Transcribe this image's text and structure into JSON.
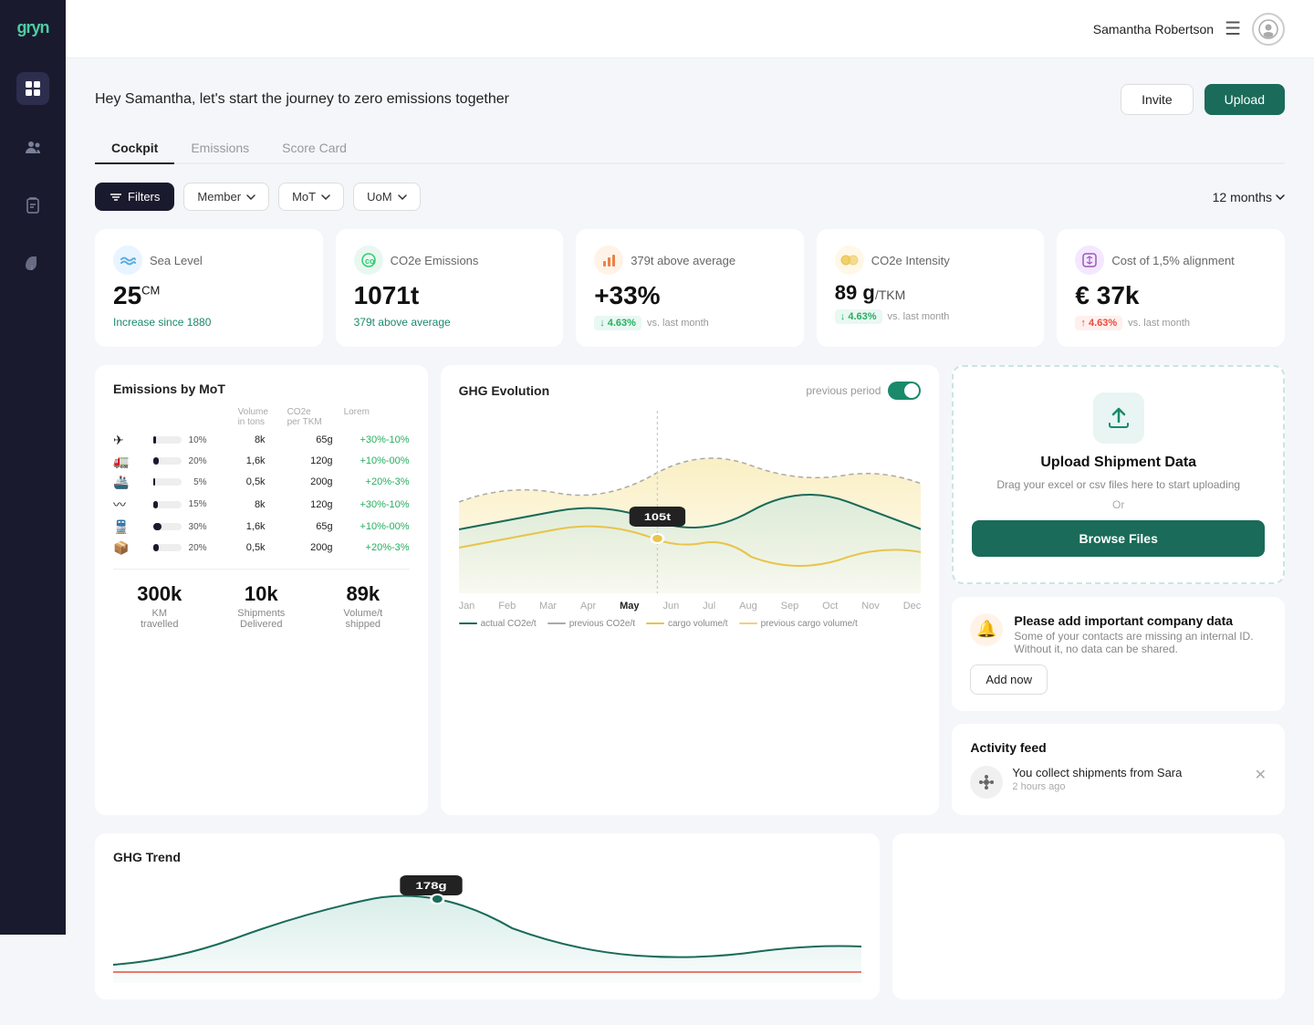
{
  "app": {
    "name": "gryn"
  },
  "topnav": {
    "username": "Samantha Robertson"
  },
  "page": {
    "greeting": "Hey Samantha, let's start the journey to zero emissions together",
    "invite_label": "Invite",
    "upload_label": "Upload"
  },
  "tabs": [
    {
      "label": "Cockpit",
      "active": true
    },
    {
      "label": "Emissions",
      "active": false
    },
    {
      "label": "Score Card",
      "active": false
    }
  ],
  "filters": {
    "filters_label": "Filters",
    "member_label": "Member",
    "mot_label": "MoT",
    "uom_label": "UoM",
    "months_label": "12 months"
  },
  "kpis": [
    {
      "icon": "sea",
      "label": "Sea Level",
      "value": "25",
      "unit": "CM",
      "sub": "Increase since 1880",
      "sub_type": "teal"
    },
    {
      "icon": "co2",
      "label": "CO2e Emissions",
      "value": "1071t",
      "unit": "",
      "sub": "379t above average",
      "sub_type": "teal"
    },
    {
      "icon": "avg",
      "label": "379t above average",
      "value": "+33%",
      "unit": "",
      "badge": "4.63%",
      "badge_type": "down",
      "vs": "vs. last month"
    },
    {
      "icon": "intensity",
      "label": "CO2e Intensity",
      "value": "89 g",
      "unit": "/TKM",
      "badge": "4.63%",
      "badge_type": "down",
      "vs": "vs. last month"
    },
    {
      "icon": "cost",
      "label": "Cost of 1,5% alignment",
      "value": "€ 37k",
      "unit": "",
      "badge": "4.63%",
      "badge_type": "up",
      "vs": "vs. last month"
    }
  ],
  "mot": {
    "title": "Emissions by MoT",
    "columns": [
      "",
      "Volume\nin tons",
      "CO2e\nper TKM",
      "Lorem"
    ],
    "rows": [
      {
        "icon": "✈",
        "pct": 10,
        "vol": "8k",
        "co2": "65g",
        "lorem": "+30%-10%"
      },
      {
        "icon": "🚛",
        "pct": 20,
        "vol": "1,6k",
        "co2": "120g",
        "lorem": "+10%-00%"
      },
      {
        "icon": "🚢",
        "pct": 5,
        "vol": "0,5k",
        "co2": "200g",
        "lorem": "+20%-3%"
      },
      {
        "icon": "🌊",
        "pct": 15,
        "vol": "8k",
        "co2": "120g",
        "lorem": "+30%-10%"
      },
      {
        "icon": "🚂",
        "pct": 30,
        "vol": "1,6k",
        "co2": "65g",
        "lorem": "+10%-00%"
      },
      {
        "icon": "📦",
        "pct": 20,
        "vol": "0,5k",
        "co2": "200g",
        "lorem": "+20%-3%"
      }
    ],
    "stats": [
      {
        "value": "300k",
        "label": "KM\ntravelled"
      },
      {
        "value": "10k",
        "label": "Shipments\nDelivered"
      },
      {
        "value": "89k",
        "label": "Volume/t\nshipped"
      }
    ]
  },
  "ghg": {
    "title": "GHG Evolution",
    "toggle_label": "previous period",
    "tooltip": "105t",
    "months": [
      "Jan",
      "Feb",
      "Mar",
      "Apr",
      "May",
      "Jun",
      "Jul",
      "Aug",
      "Sep",
      "Oct",
      "Nov",
      "Dec"
    ],
    "legend": [
      {
        "label": "actual CO2e/t",
        "color": "#1a6b5a"
      },
      {
        "label": "previous CO2e/t",
        "color": "#aaa"
      },
      {
        "label": "cargo volume/t",
        "color": "#e8c44a"
      },
      {
        "label": "previous cargo volume/t",
        "color": "#f0d080"
      }
    ]
  },
  "upload": {
    "title": "Upload Shipment Data",
    "desc": "Drag your excel or csv files here to start uploading",
    "or_label": "Or",
    "browse_label": "Browse Files"
  },
  "alert": {
    "title": "Please add important company data",
    "desc": "Some of your contacts are missing an internal ID. Without it, no data can be shared.",
    "add_label": "Add now"
  },
  "trend": {
    "title": "GHG Trend",
    "tooltip": "178g"
  },
  "activity": {
    "title": "Activity feed",
    "items": [
      {
        "text": "You collect shipments from Sara",
        "time": "2 hours ago"
      }
    ]
  }
}
